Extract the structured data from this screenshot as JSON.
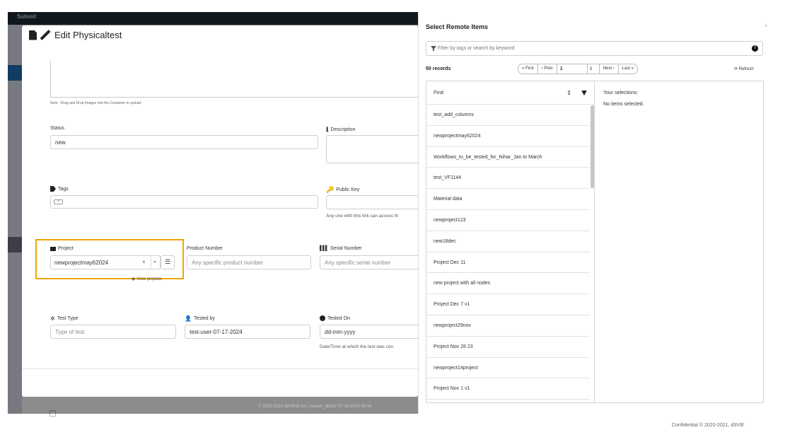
{
  "background": {
    "brand": "Submit",
    "footer": "© 2023-2024 d3VIEW Inc | master_bbdd7 07-18-2024 08:46"
  },
  "edit_modal": {
    "title": "Edit Physicaltest",
    "note": "Note : Drag and Drop Images into the Container to upload.",
    "status": {
      "label": "Status",
      "value": "new"
    },
    "description": {
      "label": "Description"
    },
    "tags": {
      "label": "Tags"
    },
    "public_key": {
      "label": "Public Key",
      "help": "Any one with this link can access th"
    },
    "project": {
      "label": "Project",
      "value": "newprojectmay62024",
      "view_link": "View projects"
    },
    "product_number": {
      "label": "Product Number",
      "placeholder": "Any specific product number"
    },
    "serial_number": {
      "label": "Serial Number",
      "placeholder": "Any specific serial number"
    },
    "test_type": {
      "label": "Test Type",
      "placeholder": "Type of test"
    },
    "tested_by": {
      "label": "Tested by",
      "value": "test-user-07-17-2024"
    },
    "tested_on": {
      "label": "Tested On",
      "placeholder": "dd-mm-yyyy",
      "help": "Date/Time at which the test was con"
    }
  },
  "remote_panel": {
    "title": "Select Remote Items",
    "close": "×",
    "filter_placeholder": "Filter by tags or search by keyword",
    "records": "50 records",
    "pager": {
      "first": "First",
      "prev": "Prev",
      "page": "1",
      "total": "3",
      "next": "Next",
      "last": "Last"
    },
    "refresh": "Refresh",
    "find_label": "Find:",
    "items": [
      "test_add_columns",
      "newprojectmay62024",
      "Workflows_to_be_tested_for_Nihar_Jan to March",
      "test_VF1144",
      "Material data",
      "newproject123",
      "new18dec",
      "Project Dec 11",
      "new project with all nodes",
      "Project Dec 7 v1",
      "newproject29nov",
      "Project Nov 28 23",
      "newproject14project",
      "Project Nov 1 v1"
    ],
    "selections_label": "Your selections:",
    "selections_empty": "No items selected."
  },
  "confidential": "Confidential © 2020-2021, d3VIE"
}
